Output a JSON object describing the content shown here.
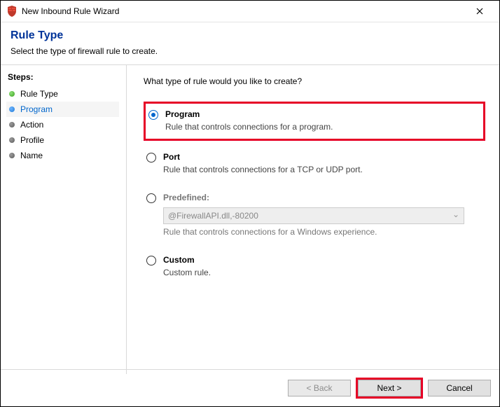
{
  "window": {
    "title": "New Inbound Rule Wizard"
  },
  "header": {
    "title": "Rule Type",
    "subtitle": "Select the type of firewall rule to create."
  },
  "sidebar": {
    "title": "Steps:",
    "items": [
      {
        "label": "Rule Type",
        "state": "completed"
      },
      {
        "label": "Program",
        "state": "current"
      },
      {
        "label": "Action",
        "state": "pending"
      },
      {
        "label": "Profile",
        "state": "pending"
      },
      {
        "label": "Name",
        "state": "pending"
      }
    ]
  },
  "main": {
    "prompt": "What type of rule would you like to create?",
    "options": {
      "program": {
        "label": "Program",
        "desc": "Rule that controls connections for a program.",
        "checked": true
      },
      "port": {
        "label": "Port",
        "desc": "Rule that controls connections for a TCP or UDP port."
      },
      "predefined": {
        "label": "Predefined:",
        "value": "@FirewallAPI.dll,-80200",
        "desc": "Rule that controls connections for a Windows experience."
      },
      "custom": {
        "label": "Custom",
        "desc": "Custom rule."
      }
    }
  },
  "footer": {
    "back": "< Back",
    "next": "Next >",
    "cancel": "Cancel"
  }
}
